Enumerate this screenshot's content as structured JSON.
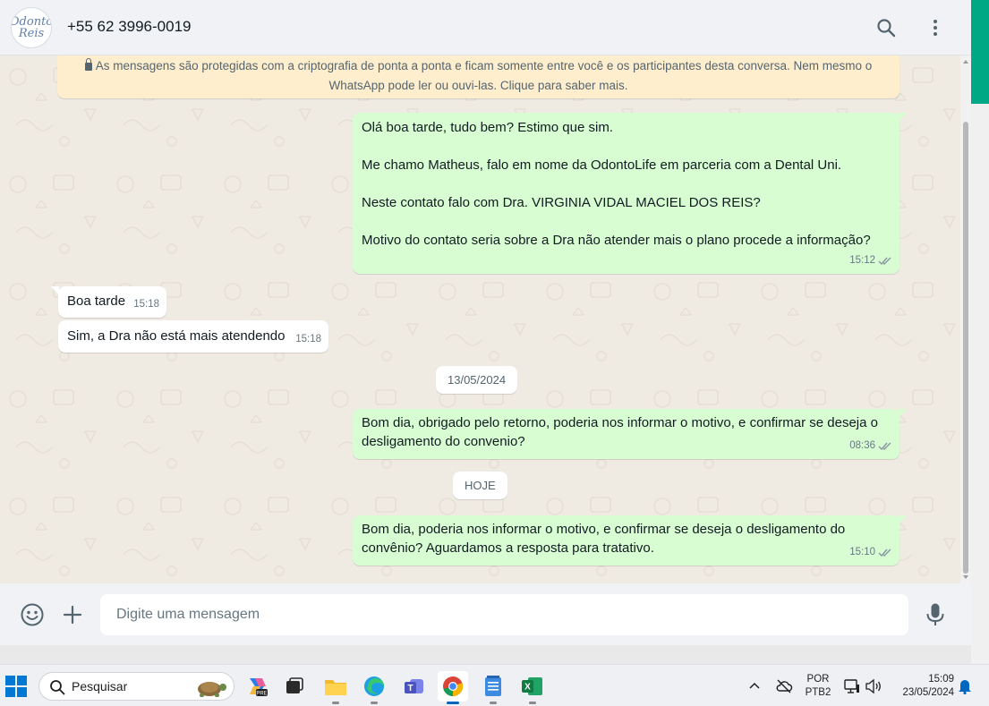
{
  "header": {
    "avatar_line1": "Odonto",
    "avatar_line2": "Reis",
    "contact_name": "+55 62 3996-0019",
    "search_icon": "search-icon",
    "menu_icon": "more-vertical-icon"
  },
  "chat": {
    "encryption_notice": "As mensagens são protegidas com a criptografia de ponta a ponta e ficam somente entre você e os participantes desta conversa. Nem mesmo o WhatsApp pode ler ou ouvi-las. Clique para saber mais.",
    "messages": [
      {
        "direction": "out",
        "text": "Olá boa tarde, tudo bem? Estimo que sim.\n\nMe chamo Matheus, falo em nome da OdontoLife em parceria com a Dental Uni.\n\nNeste contato falo com Dra. VIRGINIA VIDAL MACIEL DOS REIS?\n\nMotivo do contato seria sobre a Dra não atender mais o plano procede a informação?",
        "time": "15:12"
      },
      {
        "direction": "in",
        "text": "Boa tarde",
        "time": "15:18"
      },
      {
        "direction": "in",
        "text": "Sim, a Dra não está mais atendendo",
        "time": "15:18"
      },
      {
        "direction": "out",
        "text": "Bom dia, obrigado pelo retorno, poderia nos informar o motivo, e confirmar se deseja o desligamento do convenio?",
        "time": "08:36"
      },
      {
        "direction": "out",
        "text": "Bom dia, poderia nos informar o motivo, e confirmar se deseja o desligamento do convênio? Aguardamos a resposta para tratativo.",
        "time": "15:10"
      }
    ],
    "date_chips": [
      "13/05/2024",
      "HOJE"
    ]
  },
  "footer": {
    "input_placeholder": "Digite uma mensagem",
    "input_value": "",
    "emoji_icon": "emoji-icon",
    "attach_icon": "plus-icon",
    "mic_icon": "microphone-icon"
  },
  "taskbar": {
    "search_label": "Pesquisar",
    "language": "POR",
    "keyboard": "PTB2",
    "time": "15:09",
    "date": "23/05/2024"
  },
  "colors": {
    "outgoing_bubble": "#d9fdd3",
    "incoming_bubble": "#ffffff",
    "accent": "#00a884",
    "chat_bg": "#efeae2",
    "notice_bg": "#ffeecd"
  }
}
